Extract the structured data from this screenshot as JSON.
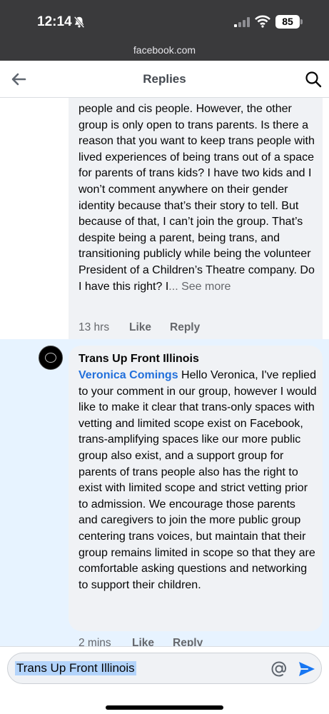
{
  "status_bar": {
    "time": "12:14",
    "battery": "85",
    "url": "facebook.com",
    "icons": [
      "bell-slash-icon",
      "signal-icon",
      "wifi-icon",
      "battery-icon"
    ]
  },
  "header": {
    "title": "Replies",
    "icons": [
      "back-arrow-icon",
      "search-icon"
    ]
  },
  "comments": [
    {
      "text": "people and cis people. However, the other group is only open to trans parents. Is there a reason that you want to keep trans people with lived experiences of being trans out of a space for parents of trans kids? I have two kids and I won’t comment anywhere on their gender identity because that’s their story to tell. But because of that, I can’t join the group. That’s despite being a parent, being trans, and transitioning publicly while being the volunteer President of a Children’s Theatre company. Do I have this right? I",
      "see_more": "... See more",
      "time_ago": "13 hrs",
      "like": "Like",
      "reply": "Reply"
    },
    {
      "author": "Trans Up Front Illinois",
      "mention": "Veronica Comings",
      "text": " Hello Veronica, I've replied to your comment in our group, however I would like to make it clear that trans-only spaces with vetting and limited scope exist on Facebook, trans-amplifying spaces like our more public group also exist, and a support group for parents of trans people also has the right to exist with limited scope and strict vetting prior to admission. We encourage those parents and caregivers to join the more public group centering trans voices, but maintain that their group remains limited in scope so that they are comfortable asking questions and networking to support their children.",
      "time_ago": "2 mins",
      "like": "Like",
      "reply": "Reply"
    }
  ],
  "composer": {
    "value": "Trans Up Front Illinois",
    "icons": [
      "at-icon",
      "send-icon"
    ]
  },
  "colors": {
    "status_bar_bg": "#3a3a3c",
    "highlight_bg": "#e7f3ff",
    "bubble_bg": "#f0f2f5",
    "mention": "#216fdb",
    "send": "#1877f2"
  }
}
